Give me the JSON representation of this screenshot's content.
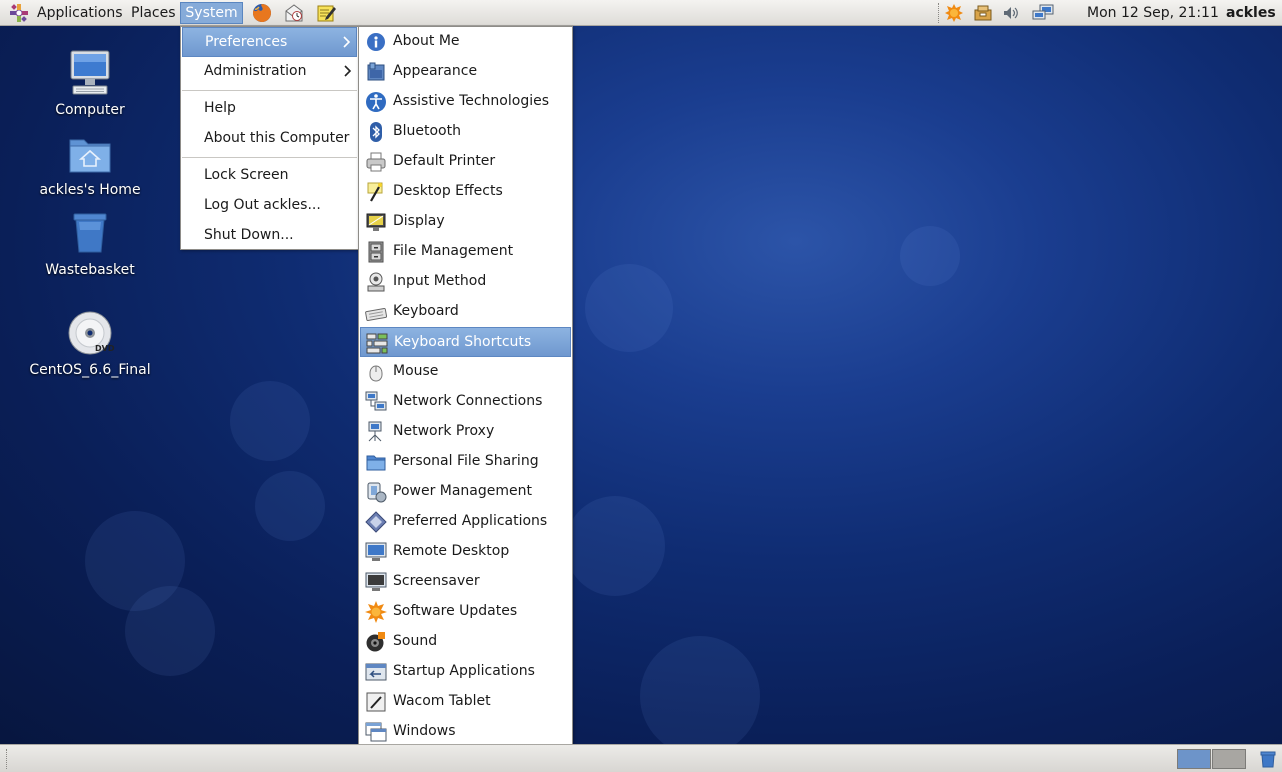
{
  "top_panel": {
    "menus": [
      "Applications",
      "Places",
      "System"
    ],
    "clock": "Mon 12 Sep, 21:11",
    "user": "ackles"
  },
  "desktop": {
    "icons": [
      "Computer",
      "ackles's Home",
      "Wastebasket",
      "CentOS_6.6_Final"
    ],
    "dvd_badge": "DVD"
  },
  "system_menu": {
    "items": [
      "Preferences",
      "Administration",
      "Help",
      "About this Computer",
      "Lock Screen",
      "Log Out ackles...",
      "Shut Down..."
    ],
    "active": "Preferences"
  },
  "preferences_menu": {
    "items": [
      {
        "label": "About Me",
        "icon": "about-me-icon"
      },
      {
        "label": "Appearance",
        "icon": "appearance-icon"
      },
      {
        "label": "Assistive Technologies",
        "icon": "accessibility-icon"
      },
      {
        "label": "Bluetooth",
        "icon": "bluetooth-icon"
      },
      {
        "label": "Default Printer",
        "icon": "printer-icon"
      },
      {
        "label": "Desktop Effects",
        "icon": "desktop-effects-icon"
      },
      {
        "label": "Display",
        "icon": "display-icon"
      },
      {
        "label": "File Management",
        "icon": "file-cabinet-icon"
      },
      {
        "label": "Input Method",
        "icon": "input-method-icon"
      },
      {
        "label": "Keyboard",
        "icon": "keyboard-icon"
      },
      {
        "label": "Keyboard Shortcuts",
        "icon": "keyboard-shortcuts-icon"
      },
      {
        "label": "Mouse",
        "icon": "mouse-icon"
      },
      {
        "label": "Network Connections",
        "icon": "network-connections-icon"
      },
      {
        "label": "Network Proxy",
        "icon": "network-proxy-icon"
      },
      {
        "label": "Personal File Sharing",
        "icon": "folder-share-icon"
      },
      {
        "label": "Power Management",
        "icon": "power-management-icon"
      },
      {
        "label": "Preferred Applications",
        "icon": "preferred-apps-icon"
      },
      {
        "label": "Remote Desktop",
        "icon": "remote-desktop-icon"
      },
      {
        "label": "Screensaver",
        "icon": "screensaver-icon"
      },
      {
        "label": "Software Updates",
        "icon": "software-updates-icon"
      },
      {
        "label": "Sound",
        "icon": "sound-icon"
      },
      {
        "label": "Startup Applications",
        "icon": "startup-apps-icon"
      },
      {
        "label": "Wacom Tablet",
        "icon": "tablet-icon"
      },
      {
        "label": "Windows",
        "icon": "windows-icon"
      }
    ],
    "highlighted": "Keyboard Shortcuts"
  },
  "colors": {
    "highlight": "#7aa3d6",
    "panel": "#e8e7e4",
    "desktop_blue": "#0f2c72"
  }
}
